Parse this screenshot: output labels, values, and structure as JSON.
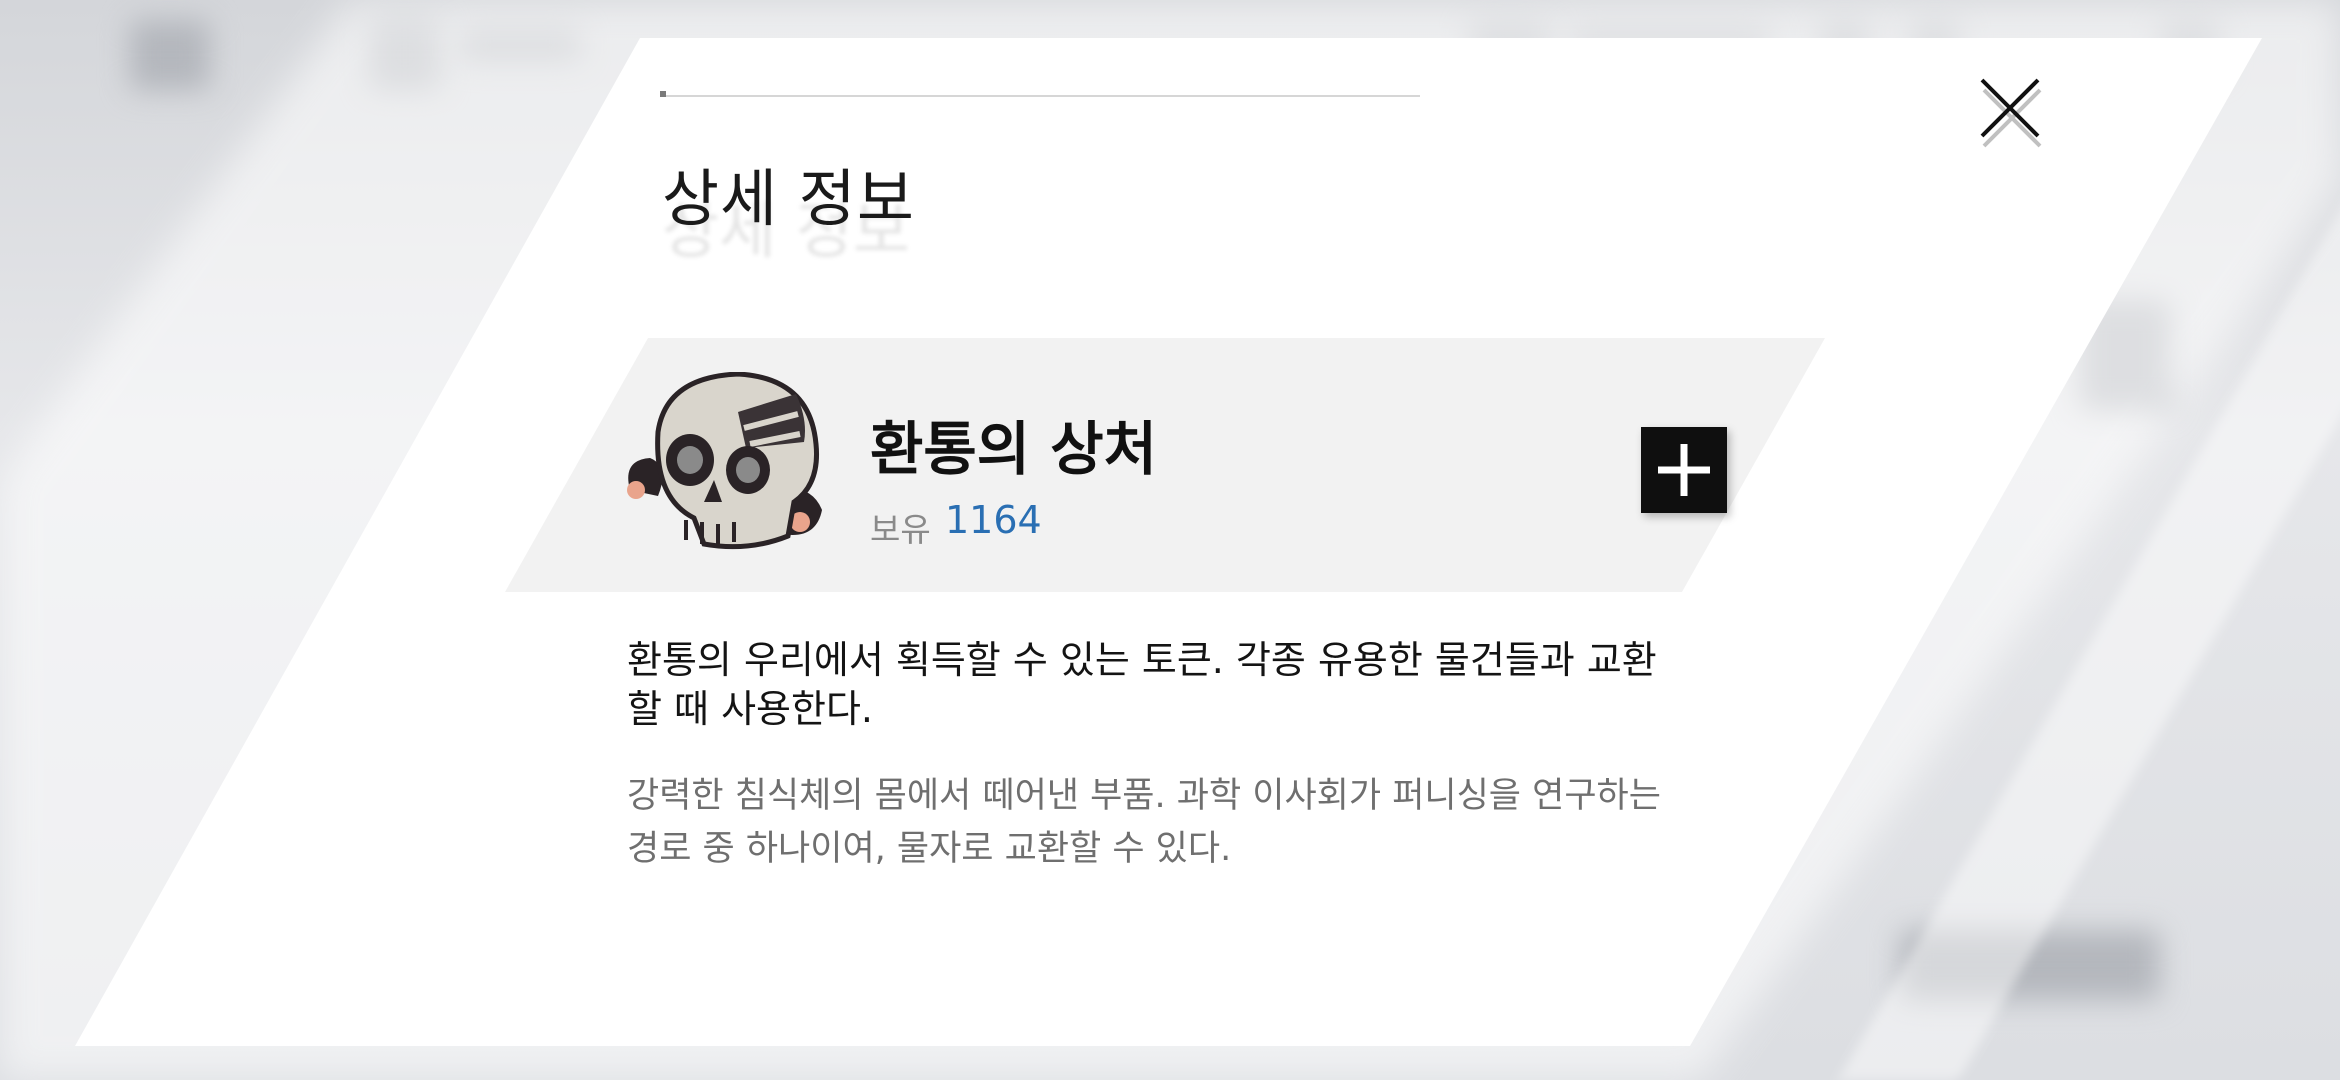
{
  "modal": {
    "title": "상세 정보",
    "close_icon": "close-icon"
  },
  "item": {
    "name": "환통의 상처",
    "owned_label": "보유",
    "owned_count": "1164",
    "icon": "skull-token-icon",
    "add_icon": "plus-icon"
  },
  "description": {
    "main": "환통의 우리에서 획득할 수 있는 토큰. 각종 유용한 물건들과 교환할 때 사용한다.",
    "flavor": "강력한 침식체의 몸에서 떼어낸 부품. 과학 이사회가 퍼니싱을 연구하는 경로 중 하나이여, 물자로 교환할 수 있다."
  },
  "colors": {
    "accent_blue": "#2a6fb3",
    "add_button": "#0f0f0f"
  }
}
